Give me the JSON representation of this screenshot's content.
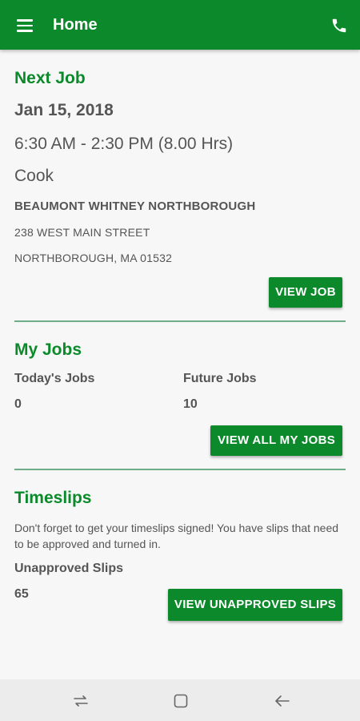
{
  "appbar": {
    "title": "Home",
    "menu_icon": "menu-icon",
    "phone_icon": "phone-icon",
    "color": "#0c8a2b"
  },
  "next_job": {
    "heading": "Next Job",
    "date": "Jan 15, 2018",
    "time": "6:30 AM - 2:30 PM (8.00 Hrs)",
    "role": "Cook",
    "location": "BEAUMONT WHITNEY NORTHBOROUGH",
    "address_line1": "238 WEST MAIN STREET",
    "address_line2": "NORTHBOROUGH, MA 01532",
    "button_label": "VIEW JOB"
  },
  "my_jobs": {
    "heading": "My Jobs",
    "today_label": "Today's Jobs",
    "today_value": "0",
    "future_label": "Future Jobs",
    "future_value": "10",
    "button_label": "VIEW ALL MY JOBS"
  },
  "timeslips": {
    "heading": "Timeslips",
    "message": "Don't forget to get your timeslips signed! You have slips that need to be approved and turned in.",
    "unapproved_label": "Unapproved Slips",
    "unapproved_value": "65",
    "button_label": "VIEW UNAPPROVED SLIPS"
  },
  "navbar": {
    "recent_icon": "recent-apps-icon",
    "home_icon": "home-icon",
    "back_icon": "back-icon"
  }
}
